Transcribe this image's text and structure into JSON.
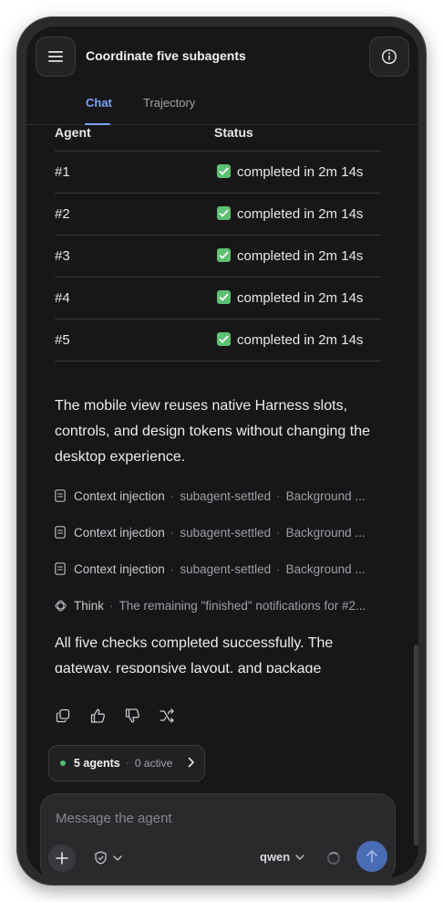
{
  "header": {
    "title": "Coordinate five subagents",
    "tabs": [
      {
        "label": "Chat",
        "active": true
      },
      {
        "label": "Trajectory",
        "active": false
      }
    ]
  },
  "table": {
    "headers": [
      "Agent",
      "Status"
    ],
    "rows": [
      {
        "agent": "#1",
        "status": "completed in 2m 14s"
      },
      {
        "agent": "#2",
        "status": "completed in 2m 14s"
      },
      {
        "agent": "#3",
        "status": "completed in 2m 14s"
      },
      {
        "agent": "#4",
        "status": "completed in 2m 14s"
      },
      {
        "agent": "#5",
        "status": "completed in 2m 14s"
      }
    ]
  },
  "message1": "The mobile view reuses native Harness slots, controls, and design tokens without changing the desktop experience.",
  "events": [
    {
      "icon": "document-icon",
      "label": "Context injection",
      "sub": "subagent-settled",
      "tail": "Background ..."
    },
    {
      "icon": "document-icon",
      "label": "Context injection",
      "sub": "subagent-settled",
      "tail": "Background ..."
    },
    {
      "icon": "document-icon",
      "label": "Context injection",
      "sub": "subagent-settled",
      "tail": "Background ..."
    },
    {
      "icon": "brain-icon",
      "label": "Think",
      "sub": "The remaining \"finished\" notifications for #2...",
      "tail": ""
    }
  ],
  "message2": "All five checks completed successfully. The gateway, responsive layout, and package metadata are ready for review.",
  "agents_pill": {
    "count": "5 agents",
    "active": "0 active"
  },
  "composer": {
    "placeholder": "Message the agent",
    "model": "qwen"
  },
  "colors": {
    "accent": "#7aa3f5",
    "success": "#5fbf73",
    "send": "#4a6cb5",
    "background": "#171719"
  }
}
